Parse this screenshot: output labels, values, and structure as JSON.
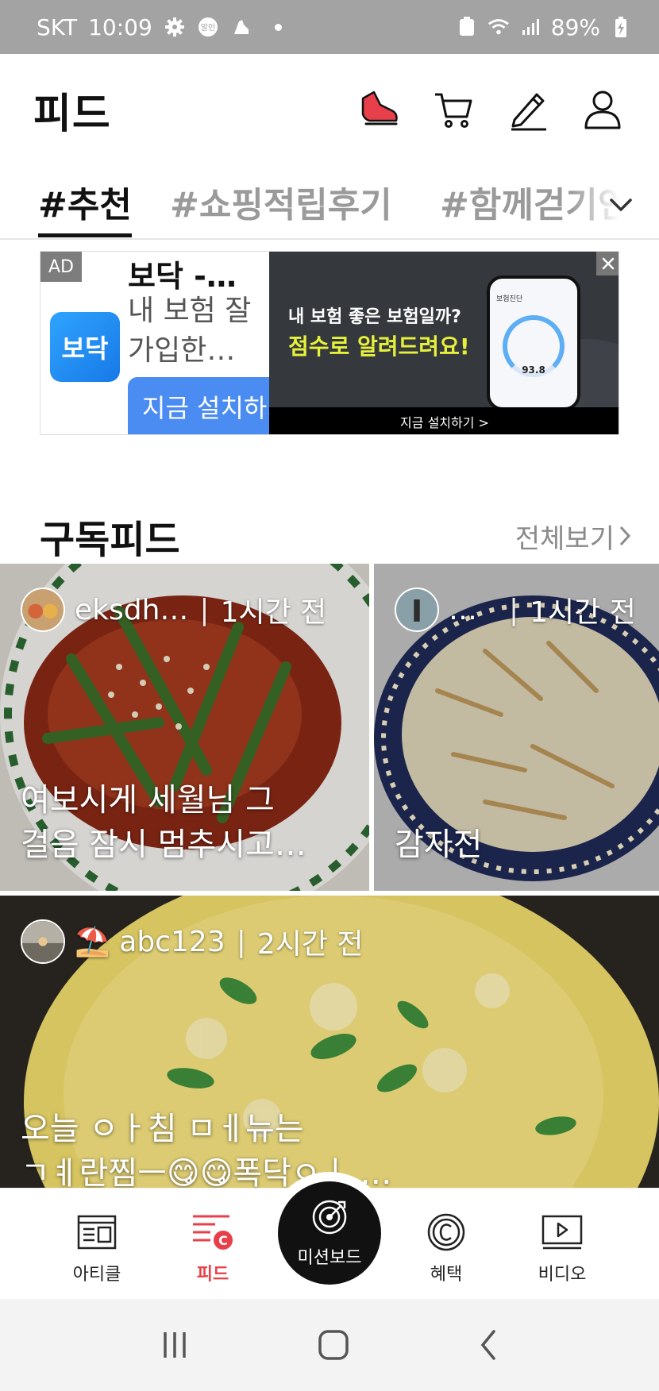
{
  "status_bar": {
    "carrier": "SKT",
    "time": "10:09",
    "badge": "알인",
    "battery": "89%"
  },
  "header": {
    "title": "피드",
    "icons": [
      "sneaker-icon",
      "cart-icon",
      "pencil-icon",
      "profile-icon"
    ]
  },
  "tabs": [
    {
      "label": "#추천",
      "active": true
    },
    {
      "label": "#쇼핑적립후기",
      "active": false
    },
    {
      "label": "#함께걷기인증",
      "active": false
    }
  ],
  "ad": {
    "tag": "AD",
    "logo_text": "보닥",
    "name": "보닥 -…",
    "description": "내 보험 잘 가입한…",
    "install_label": "지금 설치하기",
    "banner_line1": "내 보험 좋은 보험일까?",
    "banner_line2": "점수로 알려드려요!",
    "banner_cta": "지금 설치하기 >",
    "phone_title": "보험진단",
    "phone_score": "93.8",
    "accent_color": "#e6f23a"
  },
  "section": {
    "title": "구독피드",
    "see_all": "전체보기"
  },
  "cards": [
    {
      "author": "eksdh…",
      "time": "1시간 전",
      "caption": "여보시게 세월님 그\n걸음 잠시 멈추시고…"
    },
    {
      "author": "…",
      "time": "1시간 전",
      "caption": "감자전"
    },
    {
      "author": "⛱️ abc123",
      "time": "2시간 전",
      "caption": "오늘 ㅇㅏ침 ㅁㅔ뉴는\nㄱㅖ란찜ㅡ😋😋폭닥ㅇㅣ …"
    }
  ],
  "bottom_nav": {
    "items": [
      {
        "label": "아티클",
        "icon": "article-icon"
      },
      {
        "label": "피드",
        "icon": "feed-icon",
        "active": true
      },
      {
        "label": "미션보드",
        "icon": "target-icon"
      },
      {
        "label": "혜택",
        "icon": "coin-icon"
      },
      {
        "label": "비디오",
        "icon": "video-icon"
      }
    ],
    "active_color": "#e8404a"
  }
}
